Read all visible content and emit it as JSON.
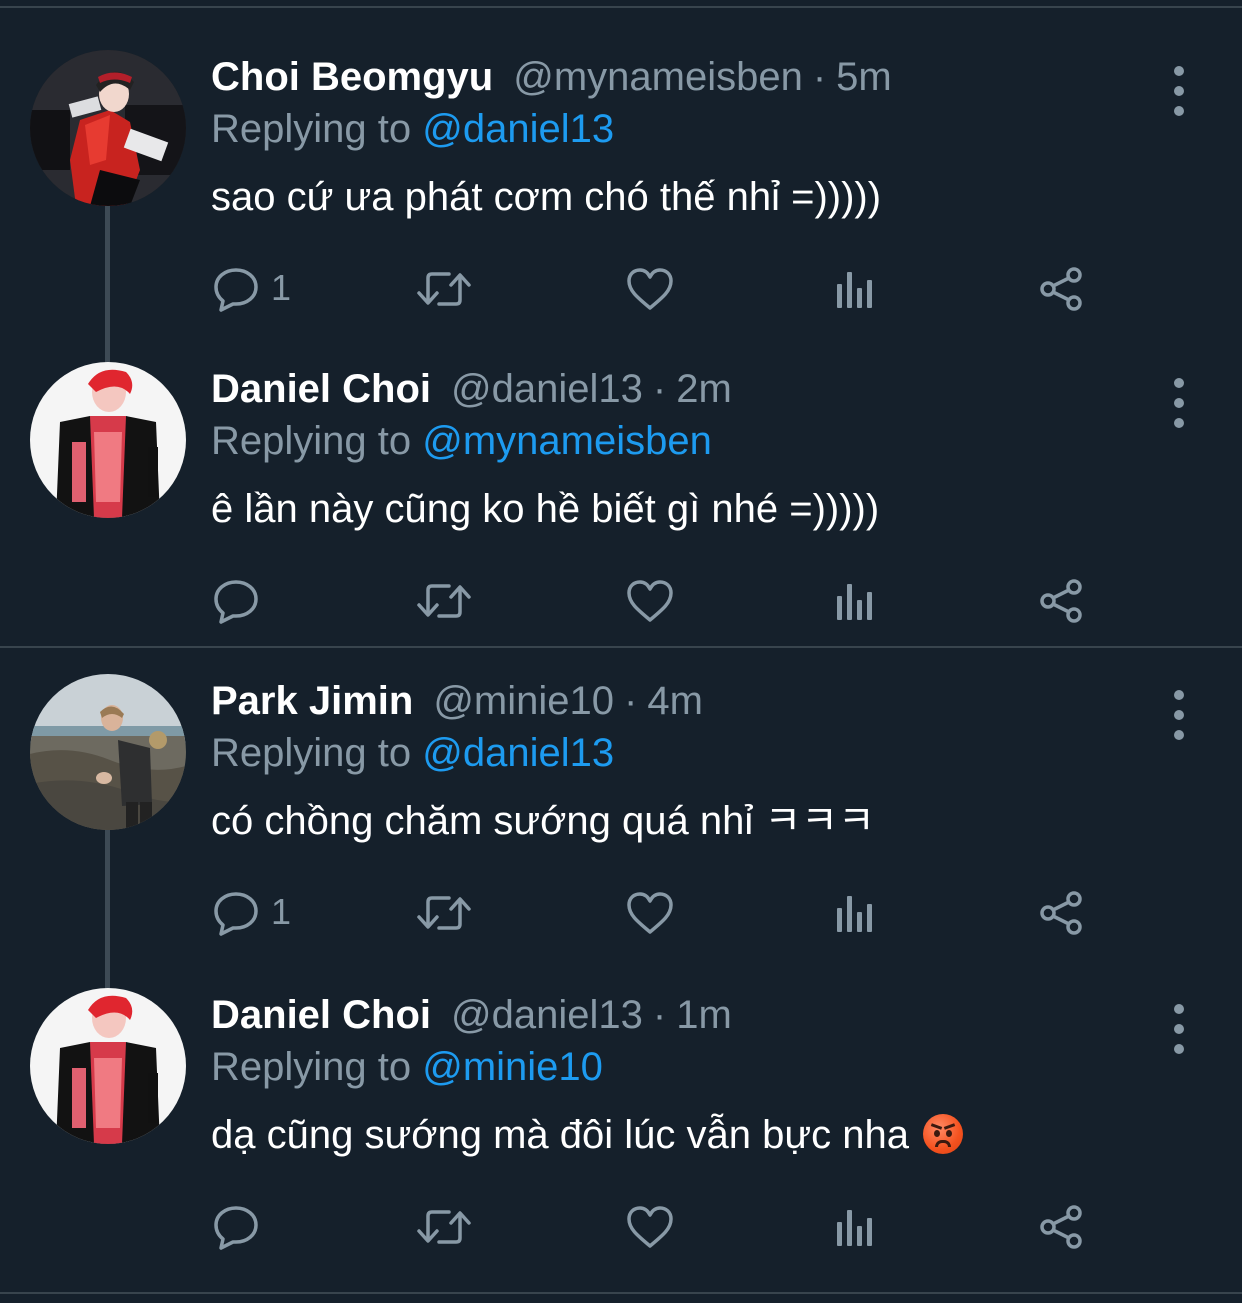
{
  "colors": {
    "background": "#15202b",
    "divider": "#38444d",
    "text": "#ffffff",
    "muted": "#8899a6",
    "link": "#1d9bf0"
  },
  "icons": {
    "reply": "speech-bubble-icon",
    "retweet": "retweet-arrows-icon",
    "like": "heart-outline-icon",
    "analytics": "bar-chart-icon",
    "share": "share-nodes-icon",
    "more": "vertical-dots-icon"
  },
  "tweets": [
    {
      "name": "Choi Beomgyu",
      "handle": "@mynameisben",
      "separator": "·",
      "time": "5m",
      "replying_prefix": "Replying to ",
      "replying_to": "@daniel13",
      "text": "sao cứ ưa phát cơm chó thế nhỉ =)))))",
      "reply_count": "1"
    },
    {
      "name": "Daniel Choi",
      "handle": "@daniel13",
      "separator": "·",
      "time": "2m",
      "replying_prefix": "Replying to ",
      "replying_to": "@mynameisben",
      "text": "ê lần này cũng ko hề biết gì nhé =)))))",
      "reply_count": ""
    },
    {
      "name": "Park Jimin",
      "handle": "@minie10",
      "separator": "·",
      "time": "4m",
      "replying_prefix": "Replying to ",
      "replying_to": "@daniel13",
      "text": "có chồng chăm sướng quá nhỉ ㅋㅋㅋ",
      "reply_count": "1"
    },
    {
      "name": "Daniel Choi",
      "handle": "@daniel13",
      "separator": "·",
      "time": "1m",
      "replying_prefix": "Replying to ",
      "replying_to": "@minie10",
      "text": "dạ cũng sướng mà đôi lúc vẫn bực nha",
      "emoji": "pouting-face-emoji",
      "reply_count": ""
    }
  ]
}
